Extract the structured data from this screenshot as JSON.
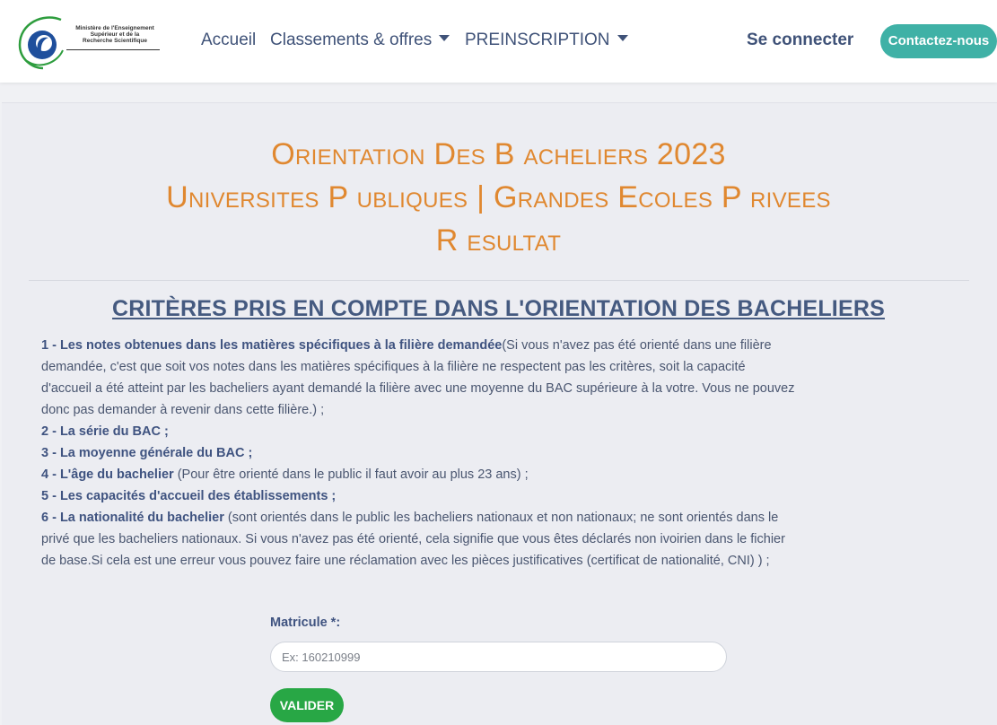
{
  "logo": {
    "line1": "Ministère de l'Enseignement",
    "line2": "Supérieur et de la",
    "line3": "Recherche Scientifique",
    "colors": {
      "blue": "#1f4f9c",
      "green": "#2e9d3e"
    }
  },
  "nav": {
    "home": "Accueil",
    "rankings": "Classements & offres",
    "preregistration": "PREINSCRIPTION",
    "login": "Se connecter",
    "contact": "Contactez-nous"
  },
  "heading": {
    "line1": "Orientation Des B acheliers 2023",
    "line2": "Universites P ubliques | Grandes Ecoles P rivees",
    "line3": "R esultat"
  },
  "criteria": {
    "title": "CRITÈRES PRIS EN COMPTE DANS L'ORIENTATION DES BACHELIERS",
    "items": [
      {
        "strong": "1 - Les notes obtenues dans les matières spécifiques à la filière demandée",
        "text": "(Si vous n'avez pas été orienté dans une filière demandée, c'est que soit vos notes dans les matières spécifiques à la filière ne respectent pas les critères, soit la capacité d'accueil a été atteint par les bacheliers ayant demandé la filière avec une moyenne du BAC supérieure à la votre. Vous ne pouvez donc pas demander à revenir dans cette filière.) ;"
      },
      {
        "strong": "2 - La série du BAC ;",
        "text": ""
      },
      {
        "strong": "3 - La moyenne générale du BAC ;",
        "text": ""
      },
      {
        "strong": "4 - L'âge du bachelier",
        "text": " (Pour être orienté dans le public il faut avoir au plus 23 ans) ;"
      },
      {
        "strong": "5 - Les capacités d'accueil des établissements ;",
        "text": ""
      },
      {
        "strong": "6 - La nationalité du bachelier",
        "text": " (sont orientés dans le public les bacheliers nationaux et non nationaux; ne sont orientés dans le privé que les bacheliers nationaux. Si vous n'avez pas été orienté, cela signifie que vous êtes déclarés non ivoirien dans le fichier de base.Si cela est une erreur vous pouvez faire une réclamation avec les pièces justificatives (certificat de nationalité, CNI) ) ;"
      }
    ]
  },
  "form": {
    "label": "Matricule *:",
    "value": "",
    "placeholder": "Ex: 160210999",
    "submit": "VALIDER"
  }
}
